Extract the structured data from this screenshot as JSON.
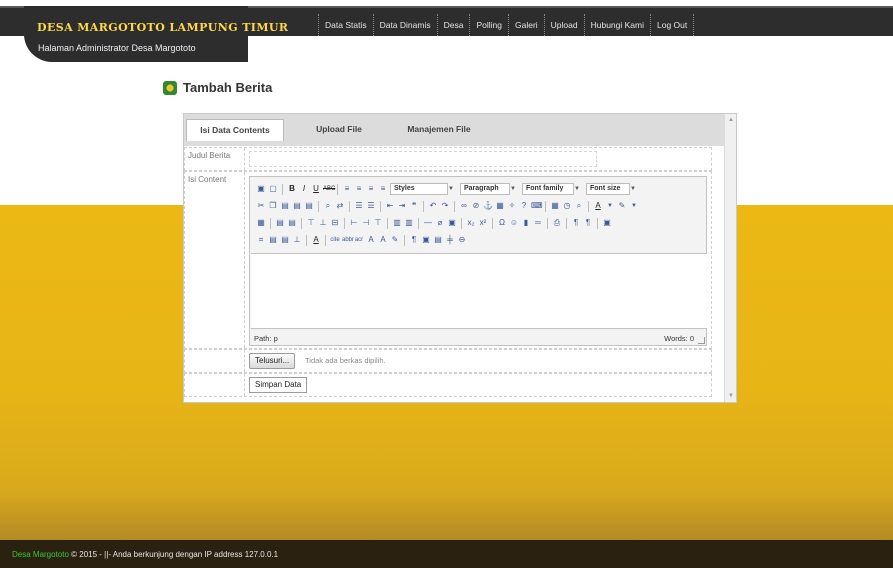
{
  "header": {
    "site_title": "DESA MARGOTOTO LAMPUNG TIMUR",
    "subtitle": "Halaman Administrator Desa Margototo",
    "nav": [
      "Data Statis",
      "Data Dinamis",
      "Desa",
      "Polling",
      "Galeri",
      "Upload",
      "Hubungi Kami",
      "Log Out"
    ]
  },
  "page": {
    "title": "Tambah Berita",
    "title_icon": "logo-emblem-icon"
  },
  "tabs": [
    "Isi Data Contents",
    "Upload File",
    "Manajemen File"
  ],
  "form": {
    "judul_label": "Judul Berita",
    "judul_value": "",
    "content_label": "Isi Content",
    "browse_label": "Telusuri...",
    "no_file_text": "Tidak ada berkas dipilih.",
    "save_label": "Simpan Data"
  },
  "editor": {
    "dropdowns": [
      "Styles",
      "Paragraph",
      "Font family",
      "Font size"
    ],
    "path": "Path: p",
    "words": "Words: 0"
  },
  "footer": {
    "brand": "Desa Margototo",
    "text": " © 2015 - ||- Anda berkunjung dengan IP address 127.0.0.1"
  },
  "colors": {
    "header_bg": "#2d2d2d",
    "gold": "#ebb814",
    "logo_text": "#ffd84a",
    "footer_bg": "#2a2110"
  }
}
